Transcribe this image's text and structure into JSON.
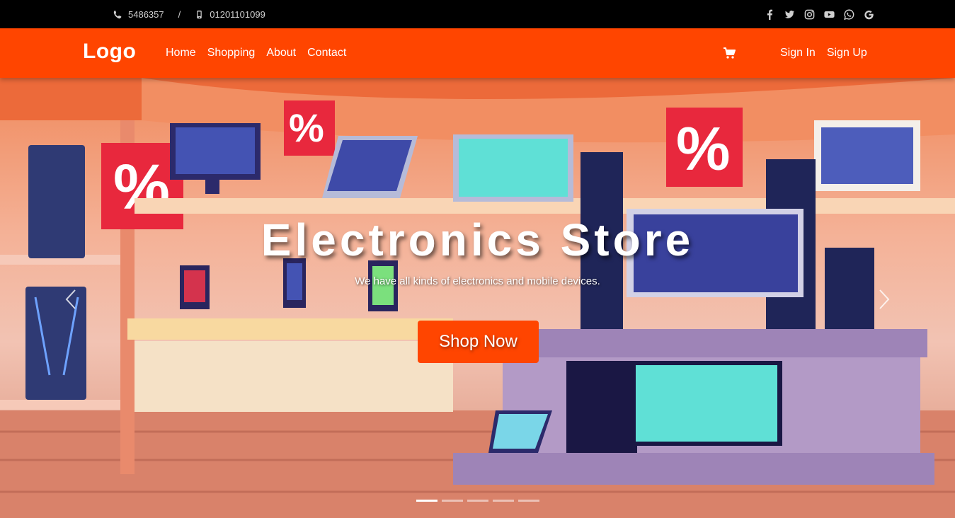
{
  "topbar": {
    "phone": "5486357",
    "separator": "/",
    "mobile": "01201101099",
    "social_icons": [
      "facebook-icon",
      "twitter-icon",
      "instagram-icon",
      "youtube-icon",
      "whatsapp-icon",
      "google-icon"
    ]
  },
  "navbar": {
    "logo": "Logo",
    "links": [
      "Home",
      "Shopping",
      "About",
      "Contact"
    ],
    "cart_icon": "cart-icon",
    "sign_in": "Sign In",
    "sign_up": "Sign Up"
  },
  "hero": {
    "title": "Electronics Store",
    "subtitle": "We have all kinds of electronics and mobile devices.",
    "button": "Shop Now",
    "slide_count": 5,
    "active_slide": 1
  },
  "colors": {
    "brand": "#ff4500",
    "topbar": "#000000",
    "text": "#ffffff"
  }
}
